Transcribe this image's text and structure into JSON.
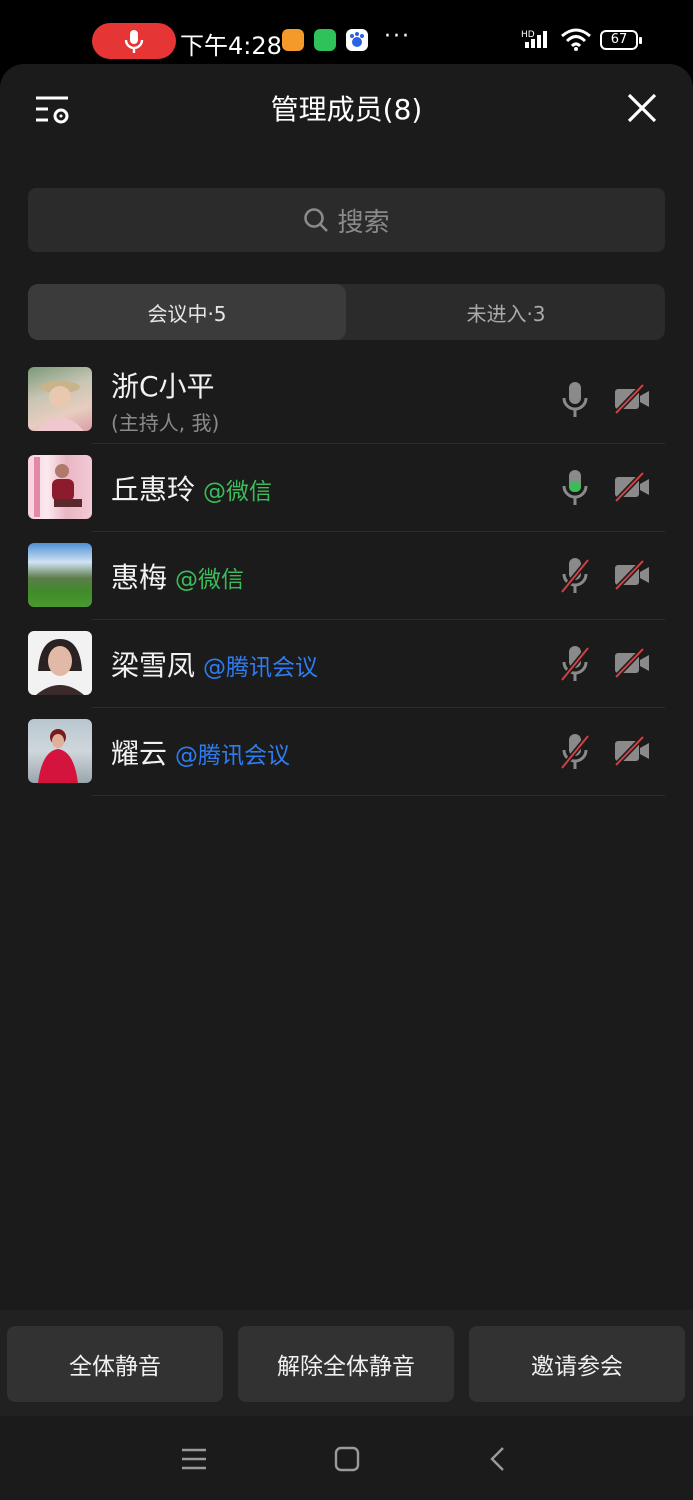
{
  "status_bar": {
    "time": "下午4:28",
    "battery": "67"
  },
  "header": {
    "title": "管理成员(8)"
  },
  "search": {
    "placeholder": "搜索"
  },
  "tabs": [
    {
      "label": "会议中·5",
      "active": true
    },
    {
      "label": "未进入·3",
      "active": false
    }
  ],
  "members": [
    {
      "name": "浙C小平",
      "sub": "(主持人, 我)",
      "source": "",
      "source_color": "",
      "mic": "on-idle",
      "camera": "off"
    },
    {
      "name": "丘惠玲",
      "sub": "",
      "source": "@微信",
      "source_color": "#3dbb5a",
      "mic": "speaking",
      "camera": "off"
    },
    {
      "name": "惠梅",
      "sub": "",
      "source": "@微信",
      "source_color": "#3dbb5a",
      "mic": "muted",
      "camera": "off"
    },
    {
      "name": "梁雪凤",
      "sub": "",
      "source": "@腾讯会议",
      "source_color": "#2f7cf0",
      "mic": "muted",
      "camera": "off"
    },
    {
      "name": "耀云",
      "sub": "",
      "source": "@腾讯会议",
      "source_color": "#2f7cf0",
      "mic": "muted",
      "camera": "off"
    }
  ],
  "actions": {
    "mute_all": "全体静音",
    "unmute_all": "解除全体静音",
    "invite": "邀请参会"
  },
  "colors": {
    "background": "#1b1b1b",
    "wechat_green": "#3dbb5a",
    "tencent_blue": "#2f7cf0",
    "muted_red": "#d14040",
    "record_red": "#e53535"
  }
}
